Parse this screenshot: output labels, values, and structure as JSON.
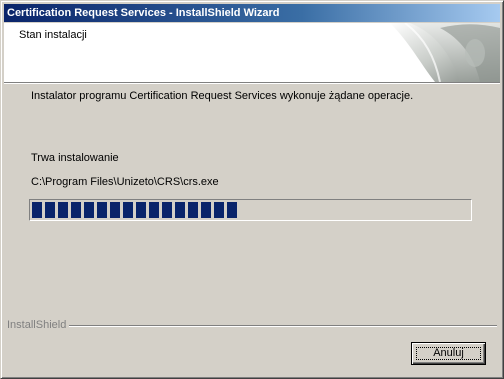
{
  "window": {
    "title": "Certification Request Services - InstallShield Wizard"
  },
  "header": {
    "title": "Stan instalacji"
  },
  "main": {
    "description": "Instalator programu Certification Request Services wykonuje żądane operacje.",
    "status": "Trwa instalowanie",
    "path": "C:\\Program Files\\Unizeto\\CRS\\crs.exe",
    "progress_fraction": 0.47
  },
  "footer": {
    "brand": "InstallShield",
    "cancel_label": "Anuluj"
  },
  "colors": {
    "title_gradient_start": "#0a246a",
    "progress_fill": "#0a246a",
    "dialog_bg": "#d4d0c8"
  }
}
